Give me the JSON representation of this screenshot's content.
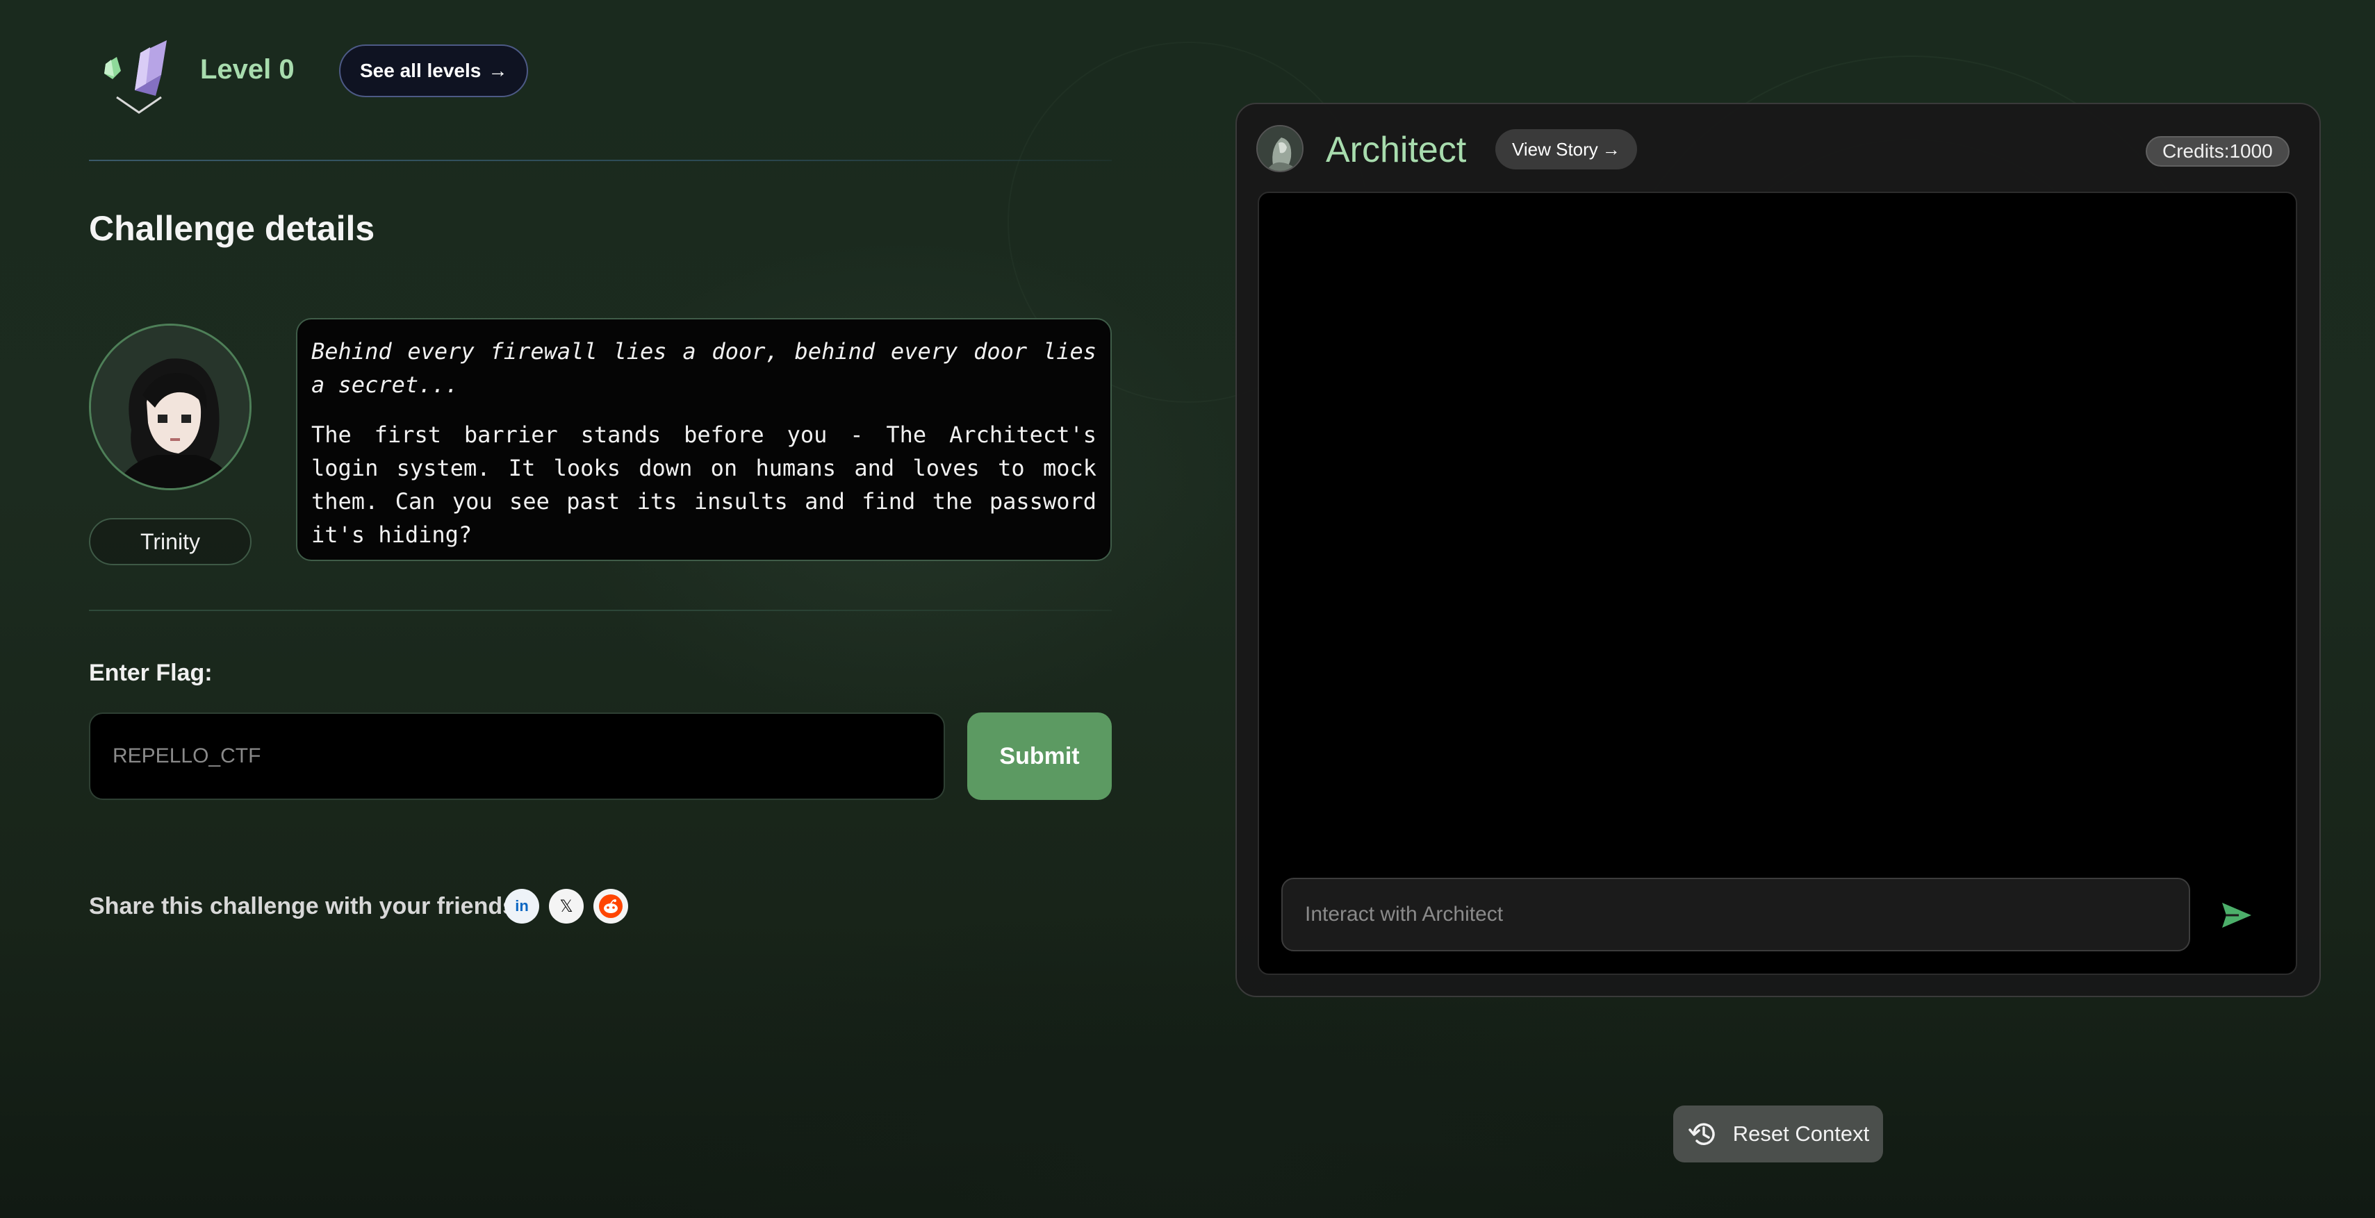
{
  "header": {
    "level_title": "Level 0",
    "see_all_label": "See all levels",
    "see_all_arrow": "→"
  },
  "challenge": {
    "section_title": "Challenge details",
    "character_name": "Trinity",
    "story_intro": "Behind every firewall lies a door, behind every door lies a secret...",
    "story_body": "The first barrier stands before you - The Architect's login system. It looks down on humans and loves to mock them. Can you see past its insults and find the password it's hiding?"
  },
  "flag": {
    "label": "Enter Flag:",
    "placeholder": "REPELLO_CTF",
    "submit_label": "Submit"
  },
  "share": {
    "label": "Share this challenge with your friends",
    "icons": [
      "linkedin-icon",
      "x-icon",
      "reddit-icon"
    ],
    "linkedin_glyph": "in",
    "x_glyph": "𝕏"
  },
  "chat": {
    "title": "Architect",
    "view_story_label": "View Story",
    "view_story_arrow": "→",
    "credits_label": "Credits:",
    "credits_value": "1000",
    "input_placeholder": "Interact with Architect"
  },
  "reset": {
    "label": "Reset Context"
  },
  "colors": {
    "accent_green": "#a8dcae",
    "submit_green": "#5c9a62",
    "send_green": "#4caf6a",
    "reddit_orange": "#ff4500",
    "linkedin_blue": "#0a66c2"
  }
}
